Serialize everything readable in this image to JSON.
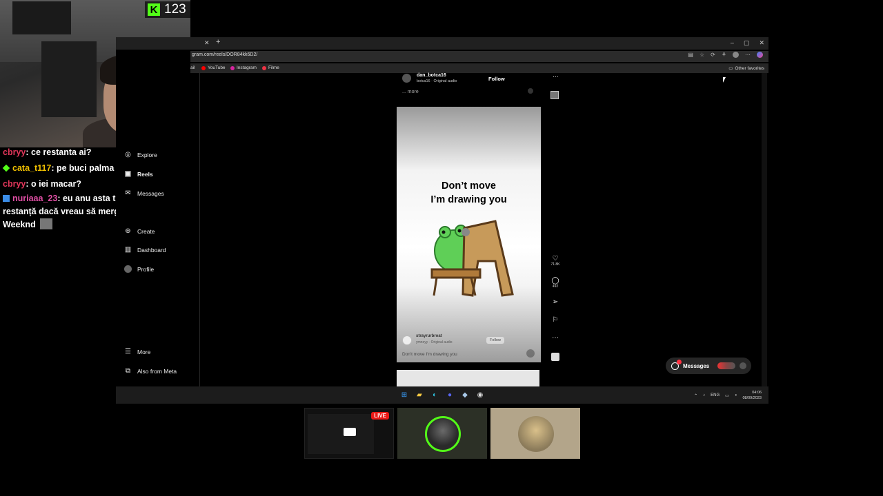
{
  "stream": {
    "viewer_count": "123",
    "cam_live_label": "LIVE"
  },
  "chat": [
    {
      "user": "cbryy",
      "user_color": "#e0365a",
      "text": ": ce restanta ai?"
    },
    {
      "user": "cata_t117",
      "user_color": "#f0c000",
      "text": ": pe buci palma"
    },
    {
      "user": "cbryy",
      "user_color": "#e0365a",
      "text": ": o iei macar?"
    },
    {
      "user": "nuriaaa_23",
      "user_color": "#e34fa6",
      "text": ": eu anu asta trb să n am nici o restanță dacă vreau să merg la concert The Weeknd"
    }
  ],
  "browser": {
    "url": "gram.com/reels/DOR84kk6D2/",
    "bookmarks": [
      "ail",
      "YouTube",
      "Instagram",
      "Filme"
    ],
    "other_favorites": "Other favorites",
    "window_controls": [
      "–",
      "▢",
      "✕"
    ]
  },
  "sidenav": {
    "items": [
      {
        "label": "Explore",
        "icon": "compass-icon"
      },
      {
        "label": "Reels",
        "icon": "reels-icon"
      },
      {
        "label": "Messages",
        "icon": "messenger-icon"
      },
      {
        "label": "Create",
        "icon": "plus-icon"
      },
      {
        "label": "Dashboard",
        "icon": "chart-icon"
      },
      {
        "label": "Profile",
        "icon": "avatar-icon"
      }
    ],
    "more": "More",
    "also_from_meta": "Also from Meta"
  },
  "reel": {
    "top_username": "dan_botca16",
    "top_audio": "botca16 · Original audio",
    "top_follow": "Follow",
    "more_text": "... more",
    "headline_line1": "Don’t move",
    "headline_line2": "I’m drawing you",
    "inner_username": "strayrurbroat",
    "inner_audio": "ymneyy · Original audio",
    "inner_follow": "Follow",
    "caption": "Don't move I'm drawing you",
    "likes": "71.8K",
    "comments": "492"
  },
  "messages_button": "Messages",
  "taskbar": {
    "lang": "ENG",
    "time": "04:06",
    "date": "08/09/2023"
  }
}
